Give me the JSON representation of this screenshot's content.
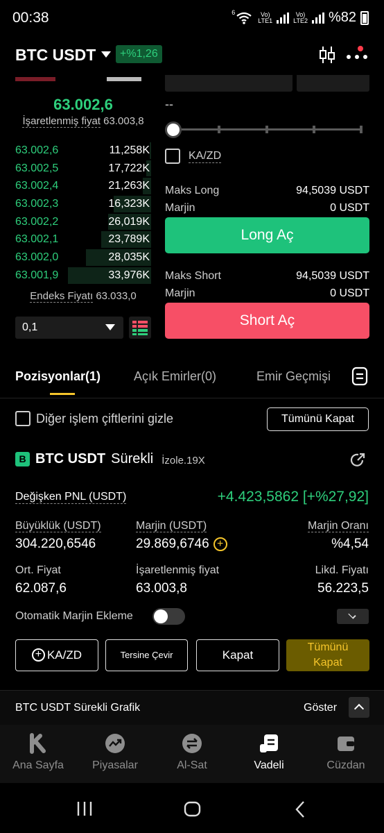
{
  "status": {
    "time": "00:38",
    "net1_top": "Vo)",
    "net1_bottom": "LTE1",
    "net2_top": "Vo)",
    "net2_bottom": "LTE2",
    "battery": "%82",
    "wifi_badge": "6"
  },
  "header": {
    "pair": "BTC USDT",
    "change": "+%1,26"
  },
  "orderbook": {
    "last_price": "63.002,6",
    "mark_label": "İşaretlenmiş fiyat",
    "mark_value": "63.003,8",
    "rows": [
      {
        "price": "63.002,6",
        "qty": "11,258K",
        "depth": 0.02
      },
      {
        "price": "63.002,5",
        "qty": "17,722K",
        "depth": 0.06
      },
      {
        "price": "63.002,4",
        "qty": "21,263K",
        "depth": 0.1
      },
      {
        "price": "63.002,3",
        "qty": "16,323K",
        "depth": 0.45
      },
      {
        "price": "63.002,2",
        "qty": "26,019K",
        "depth": 0.52
      },
      {
        "price": "63.002,1",
        "qty": "23,789K",
        "depth": 0.6
      },
      {
        "price": "63.002,0",
        "qty": "28,035K",
        "depth": 0.78
      },
      {
        "price": "63.001,9",
        "qty": "33,976K",
        "depth": 1.0
      }
    ],
    "index_label": "Endeks Fiyatı",
    "index_value": "63.033,0",
    "depth_step": "0,1"
  },
  "trade": {
    "amount_placeholder": "--",
    "tpsl_label": "KA/ZD",
    "max_long_label": "Maks Long",
    "max_long_value": "94,5039 USDT",
    "margin_label": "Marjin",
    "margin_long_value": "0 USDT",
    "long_button": "Long Aç",
    "max_short_label": "Maks Short",
    "max_short_value": "94,5039 USDT",
    "margin_short_value": "0 USDT",
    "short_button": "Short Aç"
  },
  "tabs": [
    {
      "label": "Pozisyonlar(1)"
    },
    {
      "label": "Açık Emirler(0)"
    },
    {
      "label": "Emir Geçmişi"
    }
  ],
  "positions": {
    "hide_label": "Diğer işlem çiftlerini gizle",
    "close_all": "Tümünü Kapat",
    "badge": "B",
    "name": "BTC USDT",
    "type": "Sürekli",
    "mode": "İzole.19X",
    "pnl_label": "Değişken PNL (USDT)",
    "pnl_value": "+4.423,5862 [+%27,92]",
    "size_label": "Büyüklük (USDT)",
    "size_value": "304.220,6546",
    "margin_label": "Marjin (USDT)",
    "margin_value": "29.869,6746",
    "margin_ratio_label": "Marjin Oranı",
    "margin_ratio_value": "%4,54",
    "avg_label": "Ort. Fiyat",
    "avg_value": "62.087,6",
    "mark_label": "İşaretlenmiş fiyat",
    "mark_value": "63.003,8",
    "liq_label": "Likd. Fiyatı",
    "liq_value": "56.223,5",
    "auto_margin_label": "Otomatik Marjin Ekleme",
    "btn_tpsl": "KA/ZD",
    "btn_reverse": "Tersine Çevir",
    "btn_close": "Kapat",
    "btn_close_all_1": "Tümünü",
    "btn_close_all_2": "Kapat"
  },
  "chart_bar": {
    "title": "BTC USDT Sürekli Grafik",
    "show": "Göster"
  },
  "nav": [
    {
      "label": "Ana Sayfa",
      "icon": "home-k-icon"
    },
    {
      "label": "Piyasalar",
      "icon": "markets-icon"
    },
    {
      "label": "Al-Sat",
      "icon": "trade-icon"
    },
    {
      "label": "Vadeli",
      "icon": "futures-icon"
    },
    {
      "label": "Cüzdan",
      "icon": "wallet-icon"
    }
  ],
  "colors": {
    "green": "#2ecf7c",
    "red": "#f74f66",
    "accent": "#f5c52b",
    "long_btn": "#1ec27b"
  }
}
